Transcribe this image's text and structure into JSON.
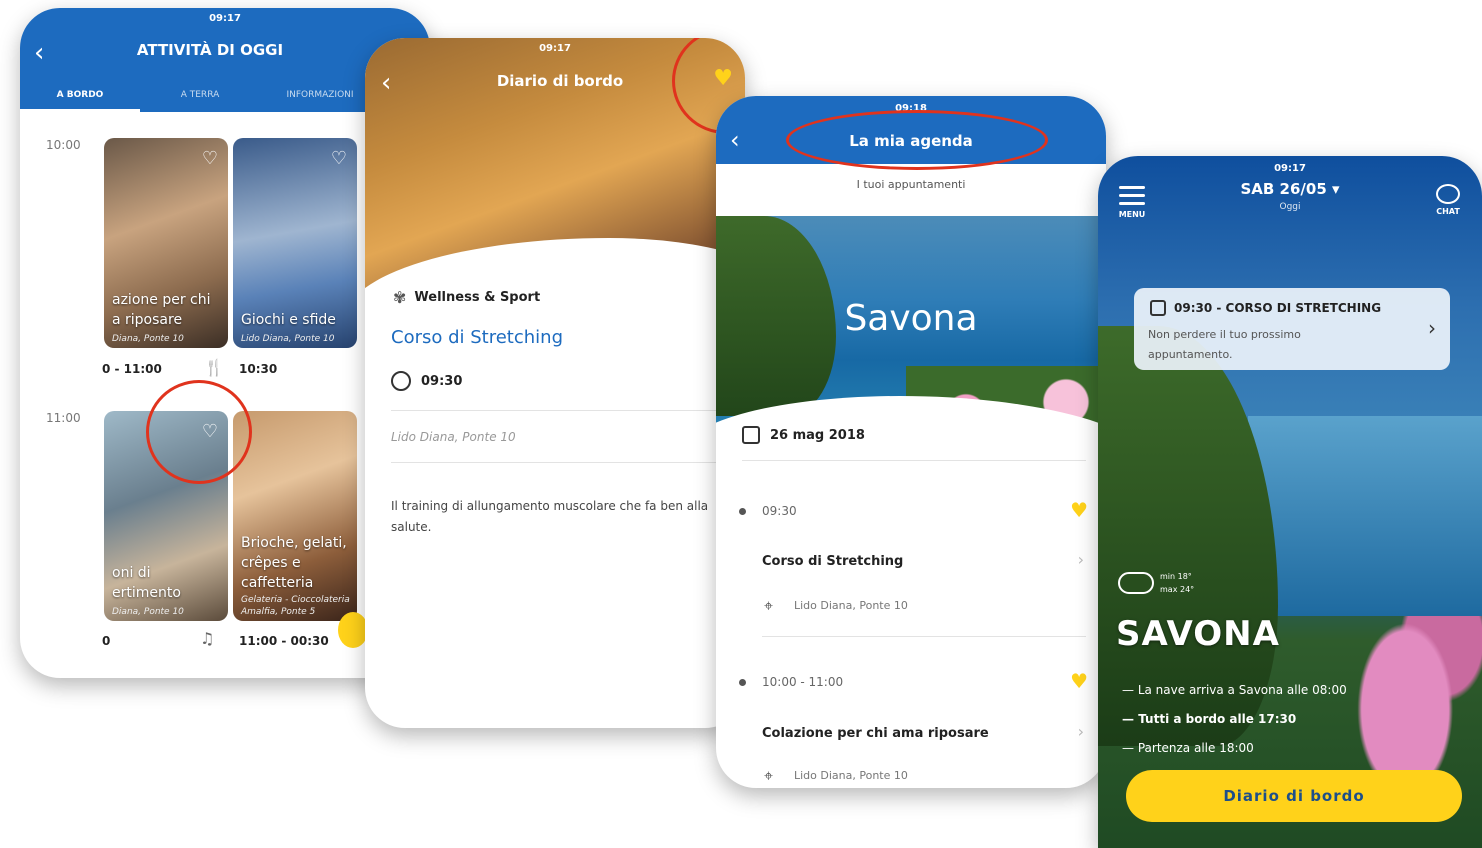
{
  "phone1": {
    "title": "ATTIVITÀ DI OGGI",
    "tabs": [
      "A BORDO",
      "A TERRA",
      "INFORMAZIONI"
    ],
    "hours": [
      "10:00",
      "11:00"
    ],
    "tiles": [
      {
        "caption_l1": "azione per chi",
        "caption_l2": "a riposare",
        "sub": "Diana, Ponte 10",
        "time": "0 - 11:00"
      },
      {
        "caption_l1": "Giochi e sfide",
        "caption_l2": "",
        "sub": "Lido Diana, Ponte 10",
        "time": "10:30"
      },
      {
        "caption_l1": "oni di",
        "caption_l2": "ertimento",
        "sub": "Diana, Ponte 10",
        "time": "0"
      },
      {
        "caption_l1": "Brioche, gelati,",
        "caption_l2": "crêpes e",
        "caption_l3": "caffetteria",
        "sub": "Gelateria - Cioccolateria",
        "sub2": "Amalfia, Ponte 5",
        "time": "11:00 - 00:30"
      }
    ]
  },
  "phone2": {
    "title": "Diario di bordo",
    "category": "Wellness & Sport",
    "activity": "Corso di Stretching",
    "time": "09:30",
    "location": "Lido Diana, Ponte 10",
    "description": "Il training di allungamento muscolare che fa ben alla salute."
  },
  "phone3": {
    "time": "09:18",
    "title": "La mia agenda",
    "subtitle": "I tuoi appuntamenti",
    "city": "Savona",
    "date": "26 mag 2018",
    "items": [
      {
        "time": "09:30",
        "name": "Corso di Stretching",
        "place": "Lido Diana, Ponte 10"
      },
      {
        "time": "10:00 - 11:00",
        "name": "Colazione per chi ama riposare",
        "place": "Lido Diana, Ponte 10"
      }
    ]
  },
  "phone4": {
    "time": "09:17",
    "date": "SAB 26/05",
    "today": "Oggi",
    "menu": "MENU",
    "chat": "CHAT",
    "card_title": "09:30 - CORSO DI STRETCHING",
    "card_text": "Non perdere il tuo prossimo appuntamento.",
    "weather_min": "min 18°",
    "weather_max": "max 24°",
    "city": "SAVONA",
    "lines": [
      "La nave arriva a Savona alle 08:00",
      "Tutti a bordo alle 17:30",
      "Partenza alle 18:00"
    ],
    "button": "Diario di bordo"
  },
  "status": {
    "p1": "09:17",
    "p2": "09:17"
  },
  "colors": {
    "brand_blue": "#1d6bbf",
    "accent_yellow": "#ffd21a",
    "highlight_red": "#e0331d"
  }
}
